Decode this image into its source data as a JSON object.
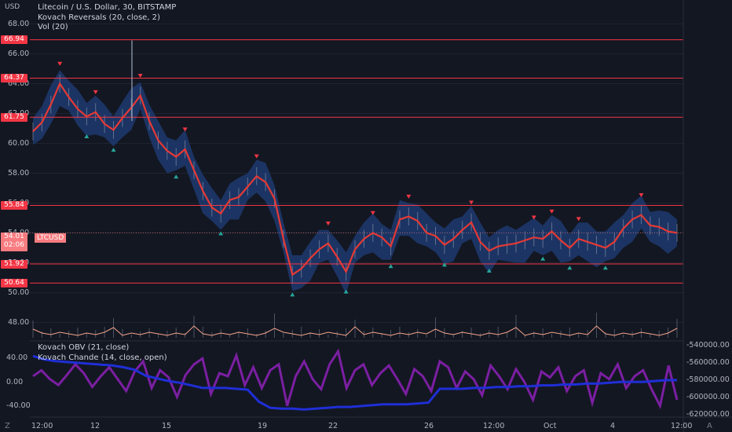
{
  "legend": {
    "title": "Litecoin / U.S. Dollar, 30, BITSTAMP",
    "indicator1": "Kovach Reversals (20, close, 2)",
    "indicator2": "Vol (20)"
  },
  "lower_legend": {
    "indicator1": "Kovach OBV (21, close)",
    "indicator2": "Kovach Chande (14, close, open)"
  },
  "axis_currency": "USD",
  "price_ticks": [
    "68.00",
    "66.00",
    "64.00",
    "62.00",
    "60.00",
    "58.00",
    "56.00",
    "54.00",
    "52.00",
    "50.00",
    "48.00"
  ],
  "level_labels": [
    "66.94",
    "64.37",
    "61.75",
    "55.84",
    "51.92",
    "50.64"
  ],
  "current_price": {
    "symbol": "LTCUSD",
    "price": "54.01",
    "countdown": "02:06"
  },
  "left_osc_ticks": [
    "40.00",
    "0.00",
    "-40.00"
  ],
  "right_osc_ticks": [
    "-540000.00",
    "-560000.00",
    "-580000.00",
    "-600000.00",
    "-620000.00"
  ],
  "time_ticks": [
    "12:00",
    "12",
    "15",
    "19",
    "22",
    "26",
    "12:00",
    "Oct",
    "4",
    "12:00"
  ],
  "buttons": {
    "z": "Z",
    "a": "A"
  },
  "colors": {
    "bg": "#131722",
    "level": "#f23645",
    "band": "#1e3a6e",
    "ma": "#e53935",
    "sell": "#f23645",
    "buy": "#26a69a",
    "chande": "#7b1fa2",
    "obv": "#1f2fd6",
    "vol": "#f4a38a"
  },
  "chart_data": {
    "type": "line",
    "title": "Litecoin / U.S. Dollar, 30, BITSTAMP",
    "ylim": [
      47.5,
      68.5
    ],
    "levels": [
      66.94,
      64.37,
      61.75,
      55.84,
      51.92,
      50.64
    ],
    "x_ticks": [
      "12:00",
      "12",
      "15",
      "19",
      "22",
      "26",
      "12:00",
      "Oct",
      "4",
      "12:00"
    ],
    "series": [
      {
        "name": "LTCUSD",
        "values": [
          60.8,
          61.4,
          62.6,
          64.0,
          63.1,
          62.3,
          61.8,
          62.1,
          61.3,
          60.9,
          61.7,
          62.4,
          63.2,
          61.5,
          60.2,
          59.5,
          59.1,
          59.6,
          58.2,
          56.8,
          55.7,
          55.3,
          56.2,
          56.4,
          57.1,
          57.8,
          57.4,
          56.3,
          53.6,
          51.2,
          51.6,
          52.3,
          52.9,
          53.3,
          52.4,
          51.4,
          52.9,
          53.6,
          54.0,
          53.7,
          53.1,
          54.9,
          55.1,
          54.8,
          54.0,
          53.8,
          53.2,
          53.6,
          54.2,
          54.7,
          53.4,
          52.8,
          53.1,
          53.2,
          53.3,
          53.5,
          53.7,
          53.6,
          54.1,
          53.5,
          53.0,
          53.6,
          53.4,
          53.2,
          53.0,
          53.4,
          54.3,
          54.9,
          55.2,
          54.5,
          54.4,
          54.1,
          54.0
        ]
      }
    ]
  },
  "osc_data": {
    "chande_ylim": [
      -55,
      55
    ],
    "chande": [
      10,
      20,
      5,
      -5,
      12,
      30,
      15,
      -8,
      10,
      25,
      5,
      -15,
      18,
      35,
      -10,
      20,
      8,
      -25,
      12,
      30,
      40,
      -20,
      15,
      10,
      45,
      -5,
      25,
      -10,
      20,
      30,
      -40,
      10,
      35,
      5,
      -12,
      30,
      52,
      -10,
      20,
      30,
      -5,
      15,
      28,
      5,
      -20,
      22,
      10,
      -15,
      35,
      25,
      -10,
      18,
      5,
      -22,
      28,
      10,
      -12,
      22,
      0,
      -30,
      18,
      8,
      25,
      -15,
      10,
      20,
      -35,
      15,
      5,
      30,
      -10,
      10,
      20,
      -12,
      -40,
      28,
      -30
    ],
    "obv_range": [
      -540000,
      -620000
    ],
    "obv": [
      -552000,
      -556000,
      -558000,
      -559000,
      -560000,
      -561000,
      -562000,
      -563000,
      -565000,
      -568000,
      -575000,
      -578000,
      -581000,
      -583000,
      -586000,
      -589000,
      -589000,
      -589000,
      -590000,
      -591000,
      -605000,
      -612000,
      -613000,
      -613000,
      -614000,
      -613000,
      -612000,
      -611000,
      -611000,
      -610000,
      -609000,
      -608000,
      -608000,
      -608000,
      -607000,
      -606000,
      -590000,
      -590000,
      -590000,
      -589000,
      -589000,
      -588000,
      -588000,
      -587000,
      -587000,
      -586000,
      -586000,
      -585000,
      -585000,
      -584000,
      -584000,
      -583000,
      -582000,
      -582000,
      -582000,
      -581000,
      -580000,
      -580000
    ]
  }
}
